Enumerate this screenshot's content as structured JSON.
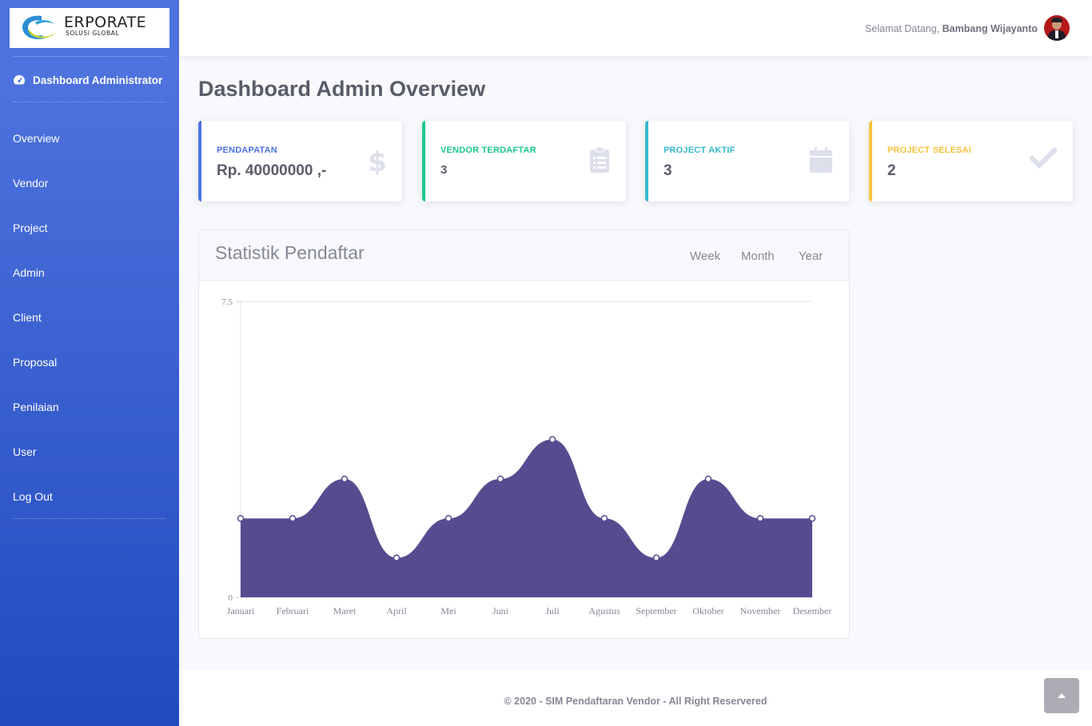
{
  "sidebar": {
    "logo": {
      "title": "ERPORATE",
      "subtitle": "SOLUSI GLOBAL"
    },
    "brand": "Dashboard Administrator",
    "items": [
      {
        "label": "Overview"
      },
      {
        "label": "Vendor"
      },
      {
        "label": "Project"
      },
      {
        "label": "Admin"
      },
      {
        "label": "Client"
      },
      {
        "label": "Proposal"
      },
      {
        "label": "Penilaian"
      },
      {
        "label": "User"
      },
      {
        "label": "Log Out"
      }
    ]
  },
  "topbar": {
    "greeting": "Selamat Datang,",
    "username": "Bambang Wijayanto"
  },
  "page_title": "Dashboard Admin Overview",
  "cards": [
    {
      "label": "PENDAPATAN",
      "value": "Rp. 40000000 ,-",
      "color": "#4e73df",
      "icon": "dollar-icon"
    },
    {
      "label": "VENDOR TERDAFTAR",
      "value": "3",
      "color": "#1cc88a",
      "icon": "clipboard-icon"
    },
    {
      "label": "PROJECT AKTIF",
      "value": "3",
      "color": "#36b9cc",
      "icon": "calendar-icon"
    },
    {
      "label": "PROJECT SELESAI",
      "value": "2",
      "color": "#f6c23e",
      "icon": "check-icon"
    }
  ],
  "panel": {
    "title": "Statistik Pendaftar",
    "tabs": [
      "Week",
      "Month",
      "Year"
    ]
  },
  "chart_data": {
    "type": "area",
    "categories": [
      "Januari",
      "Februari",
      "Maret",
      "April",
      "Mei",
      "Juni",
      "Juli",
      "Agustus",
      "September",
      "Oktober",
      "November",
      "Desember"
    ],
    "values": [
      2,
      2,
      3,
      1,
      2,
      3,
      4,
      2,
      1,
      3,
      2,
      2
    ],
    "ylim": [
      0,
      7.5
    ],
    "yticks": [
      "0",
      "7.5"
    ],
    "fill_color": "#574b90"
  },
  "footer": {
    "text": "© 2020 - SIM Pendaftaran Vendor - All Right Reservered"
  }
}
